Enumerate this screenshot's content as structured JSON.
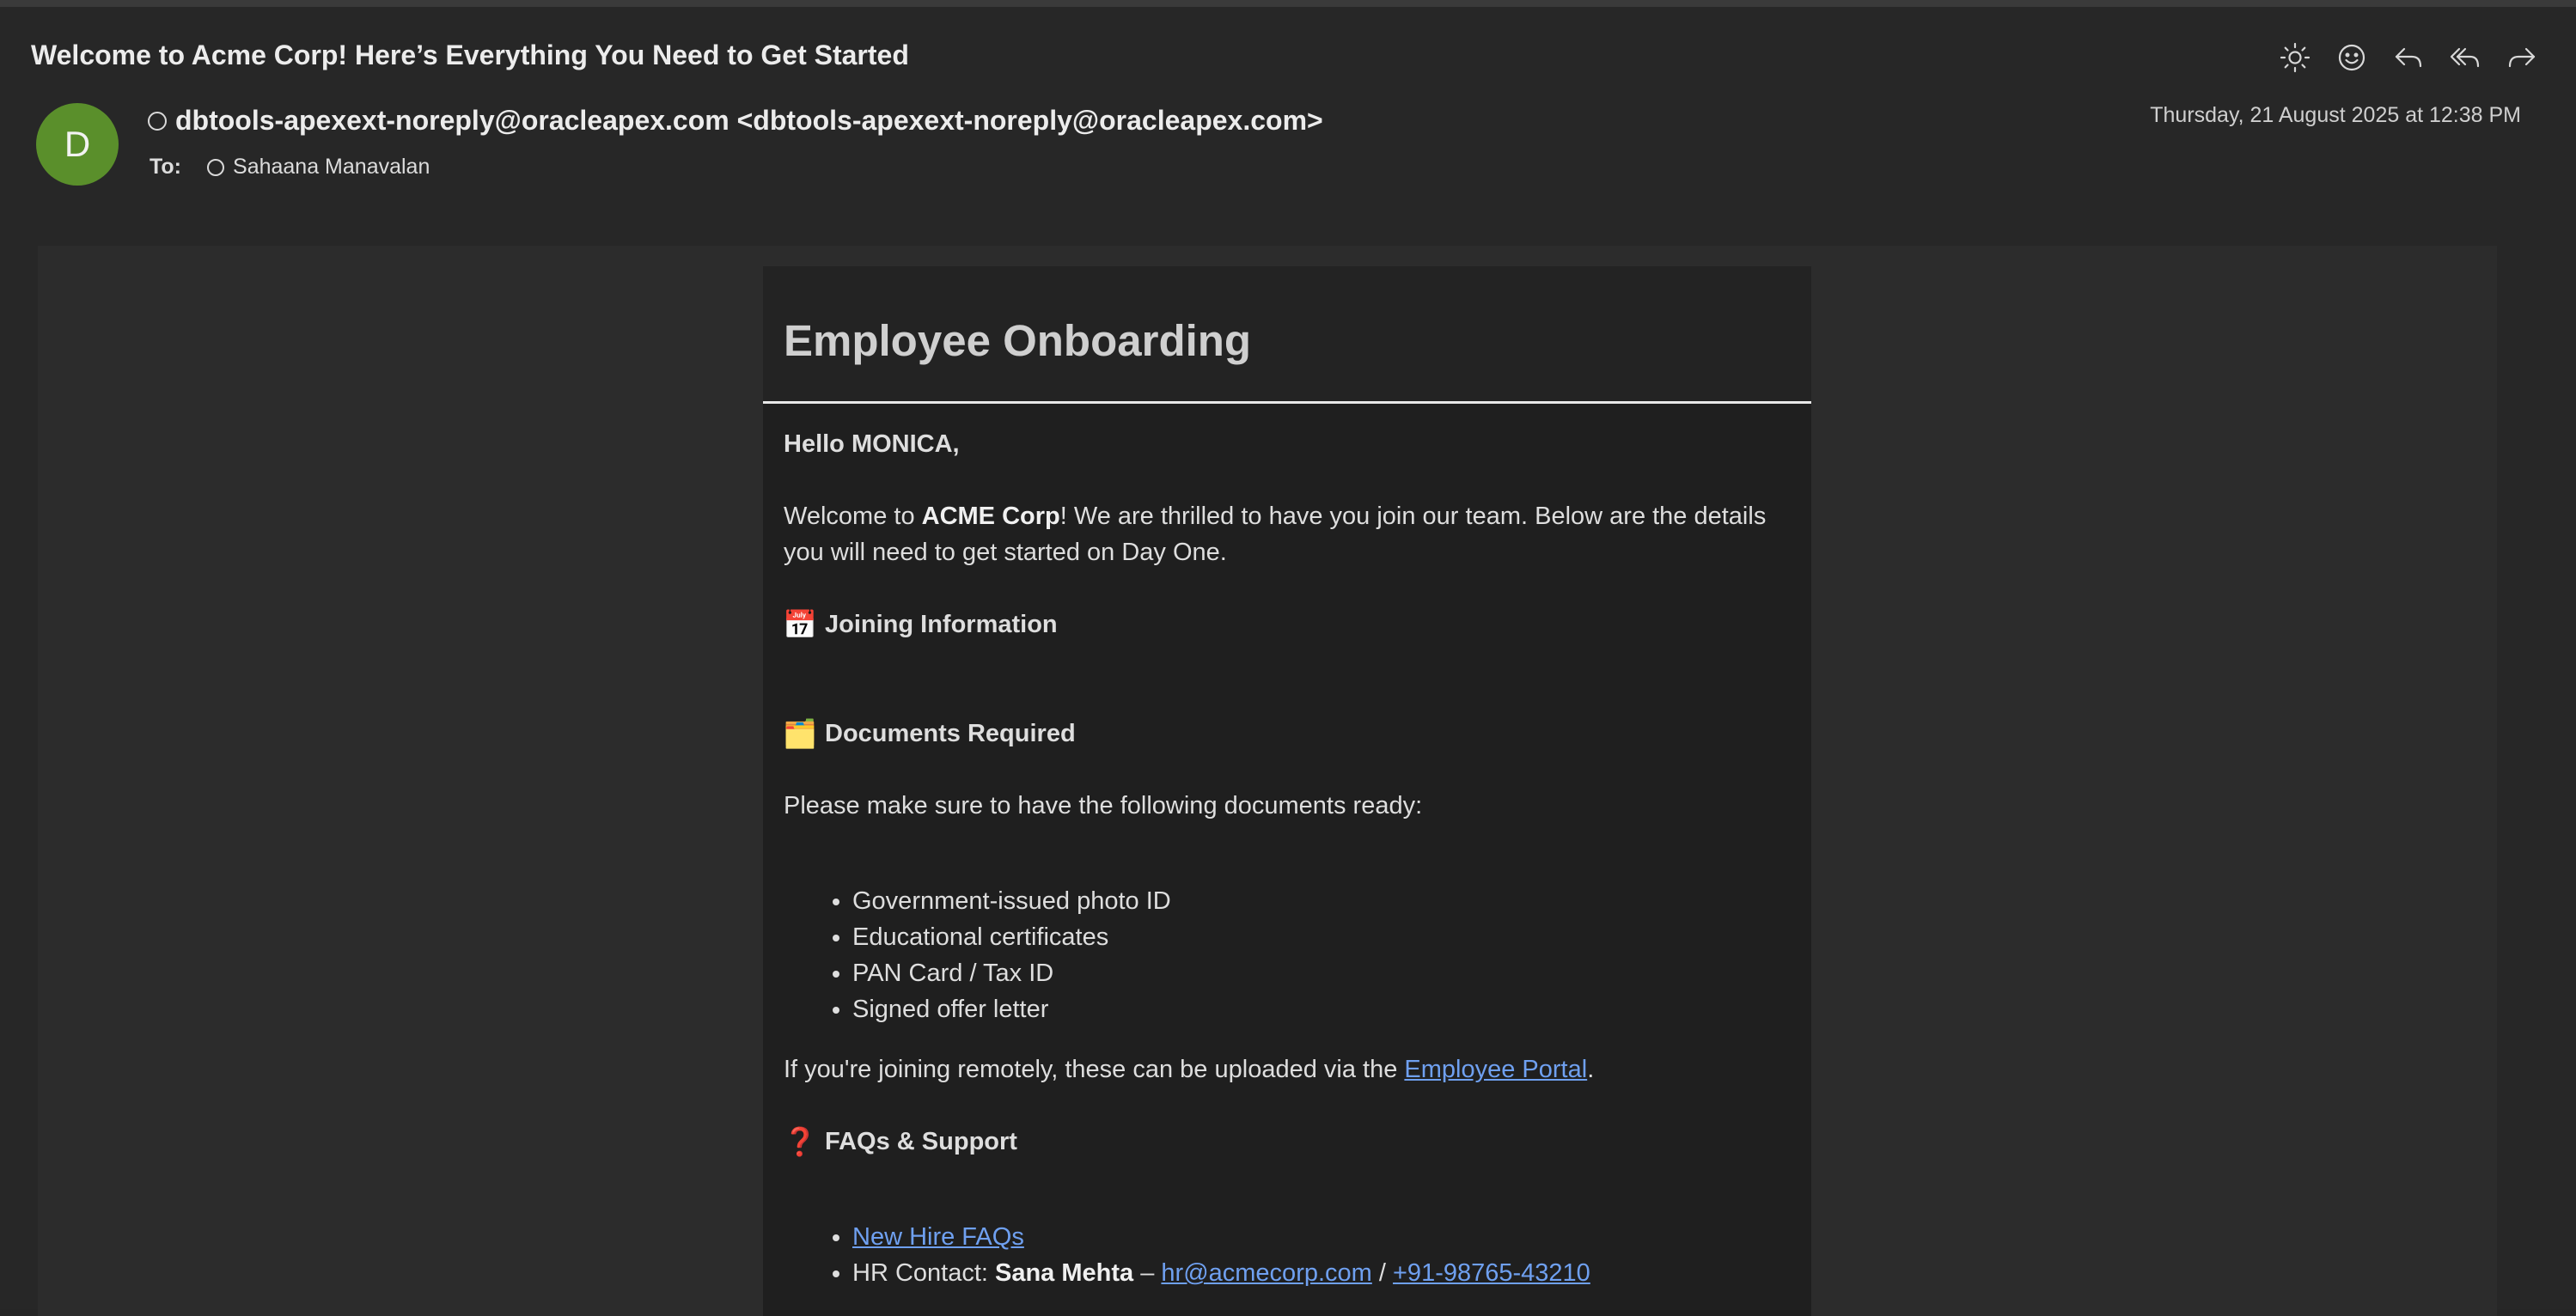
{
  "email": {
    "subject": "Welcome to Acme Corp! Here’s Everything You Need to Get Started",
    "sender_initial": "D",
    "from": "dbtools-apexext-noreply@oracleapex.com <dbtools-apexext-noreply@oracleapex.com>",
    "to_label": "To:",
    "to_name": "Sahaana Manavalan",
    "date": "Thursday, 21 August 2025 at 12:38 PM"
  },
  "toolbar": {
    "icons": [
      "brightness-icon",
      "emoji-reaction-icon",
      "reply-icon",
      "reply-all-icon",
      "forward-icon"
    ]
  },
  "body": {
    "title": "Employee Onboarding",
    "greeting": "Hello MONICA,",
    "welcome_pre": "Welcome to ",
    "company": "ACME Corp",
    "welcome_post": "! We are thrilled to have you join our team. Below are the details you will need to get started on Day One.",
    "joining_emoji": "📅",
    "joining_heading": "Joining Information",
    "documents_emoji": "🗂️",
    "documents_heading": "Documents Required",
    "documents_intro": "Please make sure to have the following documents ready:",
    "documents": [
      "Government-issued photo ID",
      "Educational certificates",
      "PAN Card / Tax ID",
      "Signed offer letter"
    ],
    "remote_pre": "If you're joining remotely, these can be uploaded via the ",
    "portal_link": "Employee Portal",
    "remote_post": ".",
    "faq_emoji": "❓",
    "faq_heading": "FAQs & Support",
    "faq_link": "New Hire FAQs",
    "hr_label": "HR Contact: ",
    "hr_name": "Sana Mehta",
    "hr_dash": " – ",
    "hr_email": "hr@acmecorp.com",
    "hr_sep": " / ",
    "hr_phone": "+91-98765-43210"
  }
}
